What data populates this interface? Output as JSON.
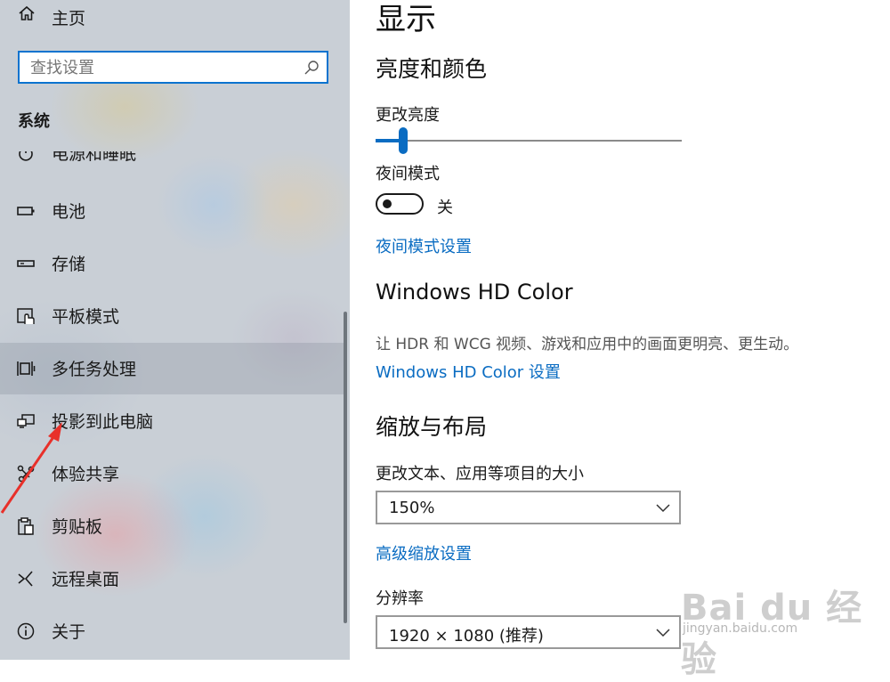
{
  "sidebar": {
    "home_label": "主页",
    "search_placeholder": "查找设置",
    "section_title": "系统",
    "items": [
      {
        "label": "电源和睡眠",
        "icon": "power-icon"
      },
      {
        "label": "电池",
        "icon": "battery-icon"
      },
      {
        "label": "存储",
        "icon": "storage-icon"
      },
      {
        "label": "平板模式",
        "icon": "tablet-mode-icon"
      },
      {
        "label": "多任务处理",
        "icon": "multitasking-icon",
        "active": true
      },
      {
        "label": "投影到此电脑",
        "icon": "project-icon"
      },
      {
        "label": "体验共享",
        "icon": "share-icon"
      },
      {
        "label": "剪贴板",
        "icon": "clipboard-icon"
      },
      {
        "label": "远程桌面",
        "icon": "remote-desktop-icon"
      },
      {
        "label": "关于",
        "icon": "info-icon"
      }
    ]
  },
  "main": {
    "title": "显示",
    "brightness_section": "亮度和颜色",
    "brightness_label": "更改亮度",
    "brightness_value": 0.09,
    "night_mode_label": "夜间模式",
    "night_mode_state": "关",
    "night_mode_link": "夜间模式设置",
    "hdr_title": "Windows HD Color",
    "hdr_desc": "让 HDR 和 WCG 视频、游戏和应用中的画面更明亮、更生动。",
    "hdr_link": "Windows HD Color 设置",
    "scale_section": "缩放与布局",
    "scale_label": "更改文本、应用等项目的大小",
    "scale_value": "150%",
    "advanced_scale_link": "高级缩放设置",
    "resolution_label": "分辨率",
    "resolution_value": "1920 × 1080 (推荐)"
  },
  "watermark": {
    "brand": "Bai du 经验",
    "site": "jingyan.baidu.com"
  },
  "colors": {
    "accent": "#0a6cc2",
    "search_border": "#0a73cf",
    "arrow": "#e8302a"
  }
}
